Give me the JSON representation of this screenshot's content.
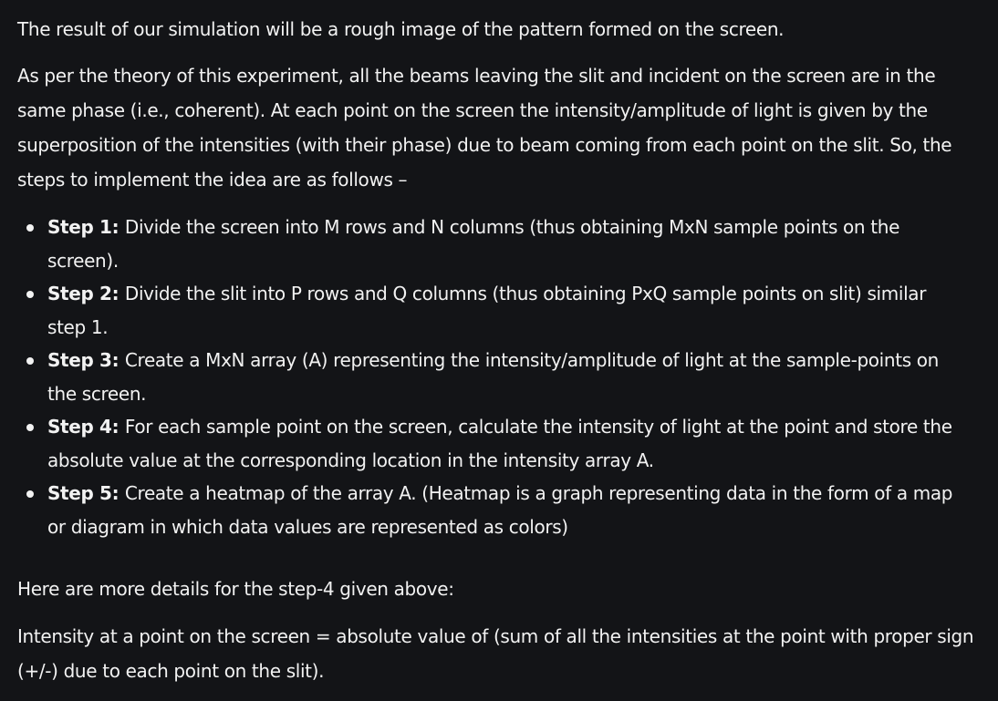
{
  "intro": "The result of our simulation will be a rough image of the pattern formed on the screen.",
  "theory": "As per the theory of this experiment, all the beams leaving the slit and incident on the screen are in the same phase (i.e., coherent). At each point on the screen the intensity/amplitude of light is given by the superposition of the intensities (with their phase) due to beam coming from each point on the slit. So, the steps to implement the idea are as follows –",
  "steps": [
    {
      "title": "Step 1:",
      "text": "Divide the screen into M rows and N columns (thus obtaining MxN sample points on the screen)."
    },
    {
      "title": "Step 2:",
      "text": "Divide the slit into P rows and Q columns (thus obtaining PxQ sample points on slit) similar step 1."
    },
    {
      "title": "Step 3:",
      "text": "Create a MxN array (A) representing the intensity/amplitude of light at the sample-points on the screen."
    },
    {
      "title": "Step 4:",
      "text": "For each sample point on the screen, calculate the intensity of light at the point and store the absolute value at the corresponding location in the intensity array A."
    },
    {
      "title": "Step 5:",
      "text": "Create a heatmap of the array A. (Heatmap is a graph representing data in the form of a map or diagram in which data values are represented as colors)"
    }
  ],
  "details_heading": "Here are more details for the step-4 given above:",
  "formula": "Intensity at a point on the screen = absolute value of (sum of all the intensities at the point with proper sign (+/-) due to each point on the slit).",
  "colors": {
    "background": "#131417",
    "text": "#f2f2f2"
  }
}
